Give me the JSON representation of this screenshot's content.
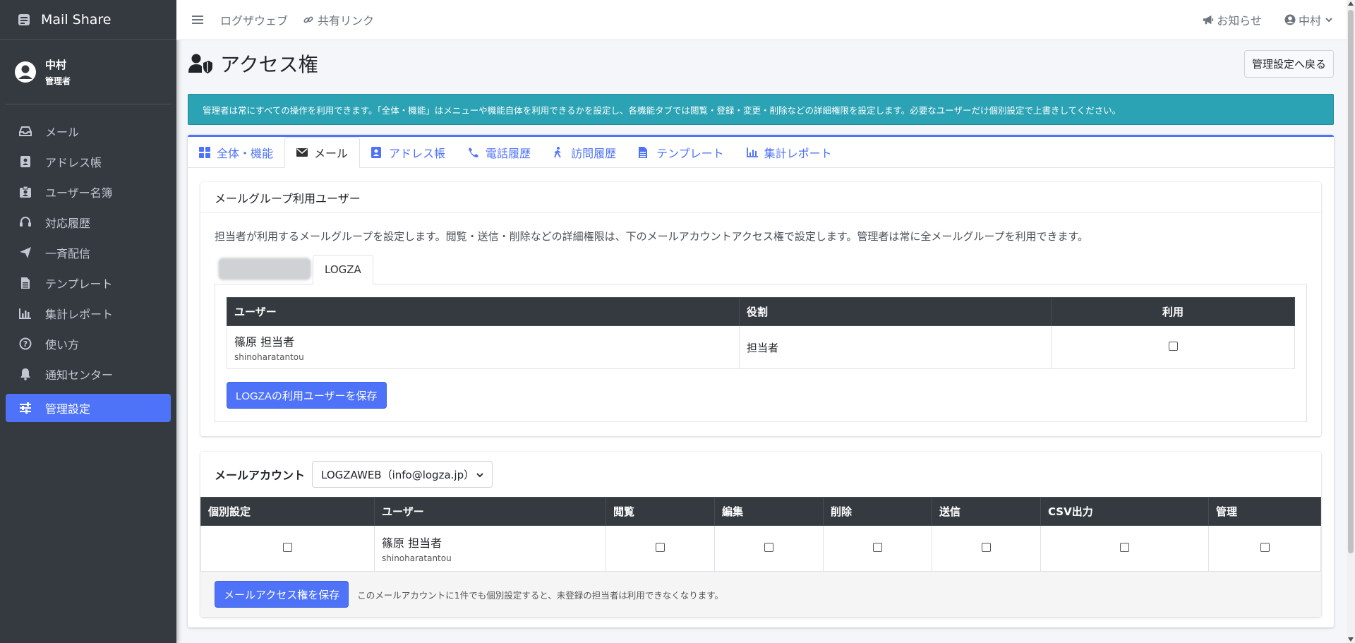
{
  "brand": {
    "name": "Mail Share",
    "icon": "envelope-box-icon"
  },
  "user": {
    "name": "中村",
    "role": "管理者"
  },
  "sidebar": {
    "items": [
      {
        "label": "メール",
        "icon": "inbox-icon"
      },
      {
        "label": "アドレス帳",
        "icon": "address-book-icon"
      },
      {
        "label": "ユーザー名簿",
        "icon": "id-badge-icon"
      },
      {
        "label": "対応履歴",
        "icon": "headset-icon"
      },
      {
        "label": "一斉配信",
        "icon": "paper-plane-icon"
      },
      {
        "label": "テンプレート",
        "icon": "file-icon"
      },
      {
        "label": "集計レポート",
        "icon": "bar-chart-icon"
      },
      {
        "label": "使い方",
        "icon": "question-circle-icon"
      },
      {
        "label": "通知センター",
        "icon": "bell-icon"
      },
      {
        "label": "管理設定",
        "icon": "sliders-icon",
        "active": true
      }
    ]
  },
  "topbar": {
    "link1": "ログザウェブ",
    "link2": "共有リンク",
    "notice": "お知らせ",
    "user": "中村"
  },
  "page": {
    "title": "アクセス権",
    "back_label": "管理設定へ戻る",
    "info": "管理者は常にすべての操作を利用できます。「全体・機能」はメニューや機能自体を利用できるかを設定し、各機能タブでは閲覧・登録・変更・削除などの詳細権限を設定します。必要なユーザーだけ個別設定で上書きしてください。"
  },
  "tabs": [
    {
      "label": "全体・機能",
      "icon": "grid-icon"
    },
    {
      "label": "メール",
      "icon": "envelope-icon",
      "active": true
    },
    {
      "label": "アドレス帳",
      "icon": "contact-card-icon"
    },
    {
      "label": "電話履歴",
      "icon": "phone-icon"
    },
    {
      "label": "訪問履歴",
      "icon": "walking-icon"
    },
    {
      "label": "テンプレート",
      "icon": "file-icon"
    },
    {
      "label": "集計レポート",
      "icon": "bar-chart-icon"
    }
  ],
  "group_section": {
    "title": "メールグループ利用ユーザー",
    "description": "担当者が利用するメールグループを設定します。閲覧・送信・削除などの詳細権限は、下のメールアカウントアクセス権で設定します。管理者は常に全メールグループを利用できます。",
    "sub_tab": "LOGZA",
    "headers": {
      "user": "ユーザー",
      "role": "役割",
      "use": "利用"
    },
    "row": {
      "name": "篠原 担当者",
      "login": "shinoharatantou",
      "role": "担当者",
      "use": false
    },
    "save_label": "LOGZAの利用ユーザーを保存"
  },
  "account_section": {
    "label": "メールアカウント",
    "selected": "LOGZAWEB（info@logza.jp）",
    "headers": [
      "個別設定",
      "ユーザー",
      "閲覧",
      "編集",
      "削除",
      "送信",
      "CSV出力",
      "管理"
    ],
    "row": {
      "name": "篠原 担当者",
      "login": "shinoharatantou",
      "individual": false,
      "view": false,
      "edit": false,
      "delete": false,
      "send": false,
      "csv": false,
      "admin": false
    },
    "save_label": "メールアクセス権を保存",
    "note": "このメールアカウントに1件でも個別設定すると、未登録の担当者は利用できなくなります。"
  },
  "colors": {
    "sidebar_bg": "#343a40",
    "primary": "#4e73f8",
    "info": "#2ba3b5",
    "table_header": "#343a40"
  }
}
